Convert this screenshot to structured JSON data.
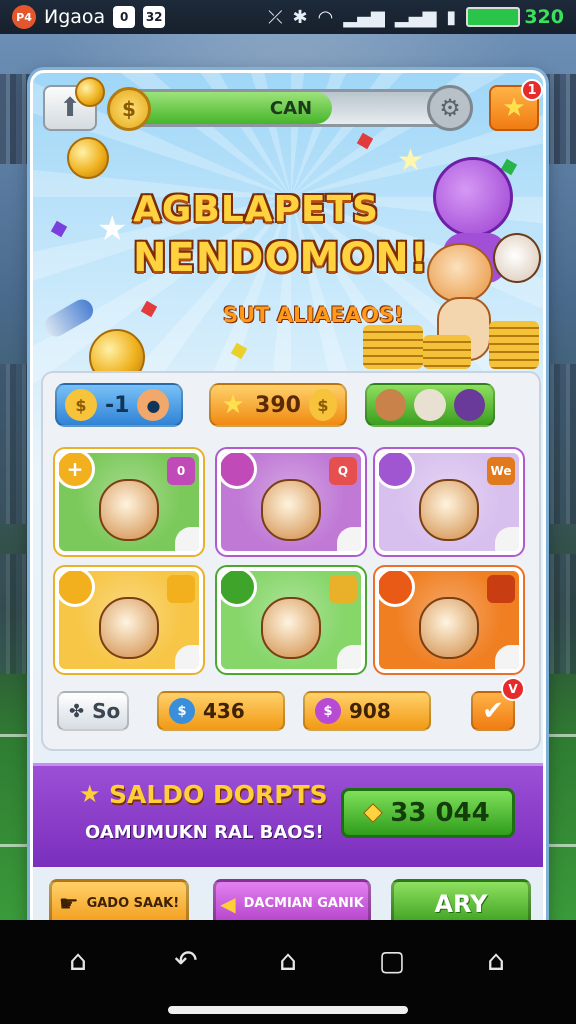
{
  "status_bar": {
    "app_name": "Иgaoa",
    "badge": "P4",
    "box1": "0",
    "box2": "32",
    "battery": "320"
  },
  "top_bar": {
    "progress_label": "CAN",
    "progress_fraction": 0.62,
    "star_badge": "1"
  },
  "hero": {
    "title_line1": "AGBLAPETS",
    "title_line2": "NENDOMON!",
    "subtitle": "SUT ALIAEAOS!"
  },
  "pills": [
    {
      "label": "-1",
      "color": "#3d95e0"
    },
    {
      "label": "390",
      "color": "#f29a16"
    },
    {
      "label": "",
      "color": "#58b52c"
    }
  ],
  "cards": [
    {
      "tl": "+",
      "tr": "0",
      "bg": "#7bc95a",
      "tl_color": "#f2b01e",
      "tr_color": "#c04ab8",
      "border": "#e9b02a"
    },
    {
      "tl": "",
      "tr": "Q",
      "bg": "#c07ad6",
      "tl_color": "#c04ab8",
      "tr_color": "#e64f4f",
      "border": "#b05ad0"
    },
    {
      "tl": "",
      "tr": "We",
      "bg": "#d7c0ee",
      "tl_color": "#a056d0",
      "tr_color": "#e07a1c",
      "border": "#b05ad0"
    },
    {
      "tl": "",
      "tr": "",
      "bg": "#f7c646",
      "tl_color": "#f2b01e",
      "tr_color": "#f2b01e",
      "border": "#e9b02a"
    },
    {
      "tl": "",
      "tr": "",
      "bg": "#86d66a",
      "tl_color": "#3fa42a",
      "tr_color": "#e9b02a",
      "border": "#4aa82e"
    },
    {
      "tl": "",
      "tr": "",
      "bg": "#f07f22",
      "tl_color": "#e85a16",
      "tr_color": "#c83d12",
      "border": "#e9712a"
    }
  ],
  "bottom_row": {
    "left_label": "So",
    "mid_value": "436",
    "right_value": "908",
    "check_badge": "V"
  },
  "banner": {
    "title": "SALDO DORPTS",
    "subtitle": "OAMUMUKN RAL BAOS!",
    "counter": "33 044"
  },
  "buttons": [
    {
      "label": "GADO SAAK!",
      "color": "#f7b62a"
    },
    {
      "label": "DACMIAN GANIK",
      "color": "#c24fd4"
    },
    {
      "label": "ARY",
      "color": "#4cb52e"
    }
  ],
  "nav": [
    "home-icon",
    "back-icon",
    "house-icon",
    "square-icon",
    "home-outline-icon"
  ]
}
